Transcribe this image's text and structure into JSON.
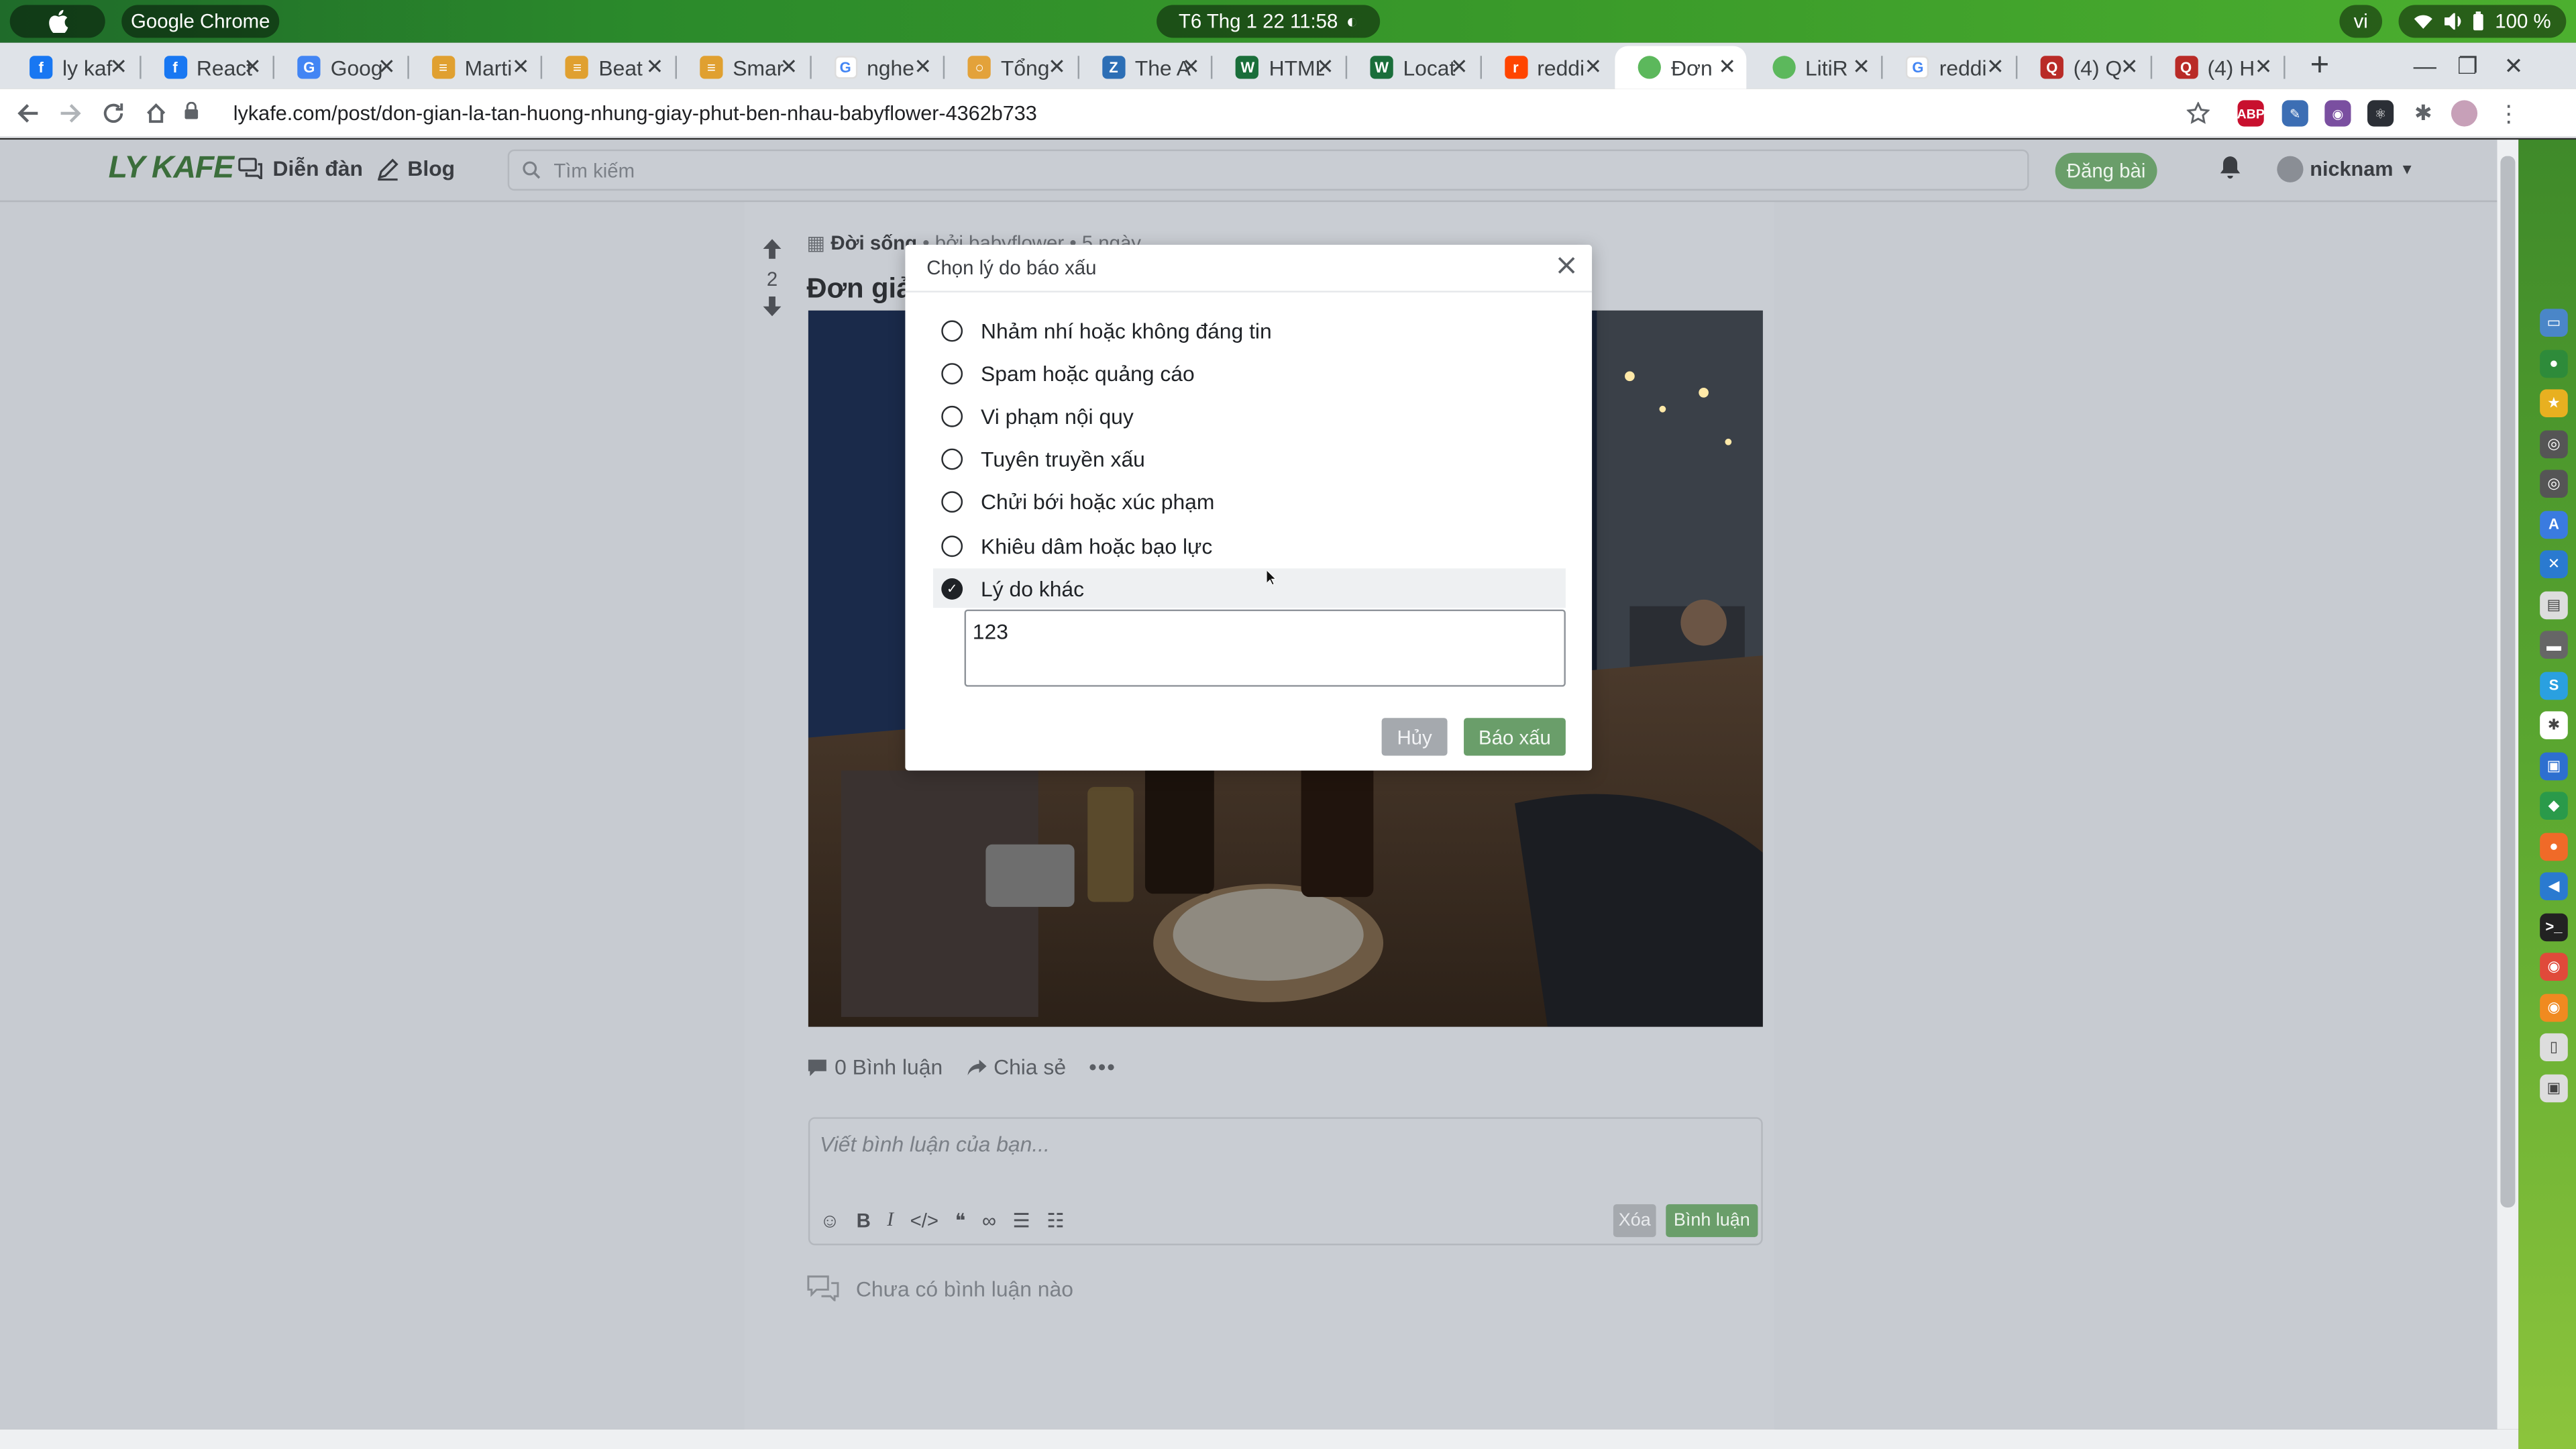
{
  "system_bar": {
    "app_name": "Google Chrome",
    "clock": "T6 Thg 1 22  11:58",
    "input_language": "vi",
    "battery": "100 %"
  },
  "browser": {
    "tabs": [
      {
        "label": "ly kaf",
        "favicon": "facebook-icon",
        "color": "#1877f2",
        "glyph": "f"
      },
      {
        "label": "React",
        "favicon": "facebook-icon",
        "color": "#1877f2",
        "glyph": "f"
      },
      {
        "label": "Goog",
        "favicon": "google-docs-icon",
        "color": "#4285f4",
        "glyph": "G"
      },
      {
        "label": "Marti",
        "favicon": "burger-icon",
        "color": "#e0a030",
        "glyph": "≡"
      },
      {
        "label": "Beat",
        "favicon": "burger-icon",
        "color": "#e0a030",
        "glyph": "≡"
      },
      {
        "label": "Smar",
        "favicon": "burger-icon",
        "color": "#e0a030",
        "glyph": "≡"
      },
      {
        "label": "nghe",
        "favicon": "google-icon",
        "color": "#ffffff",
        "glyph": "G"
      },
      {
        "label": "Tổng",
        "favicon": "circle-icon",
        "color": "#e3a23a",
        "glyph": "○"
      },
      {
        "label": "The A",
        "favicon": "blue-z-icon",
        "color": "#2c6eb5",
        "glyph": "Z"
      },
      {
        "label": "HTML",
        "favicon": "wiki-w-icon",
        "color": "#1a6e3a",
        "glyph": "W"
      },
      {
        "label": "Locat",
        "favicon": "wiki-w-icon",
        "color": "#1a6e3a",
        "glyph": "W"
      },
      {
        "label": "reddi",
        "favicon": "reddit-icon",
        "color": "#ff4500",
        "glyph": "r"
      },
      {
        "label": "Đơn",
        "favicon": "green-dot-icon",
        "color": "#5cb85c",
        "glyph": "",
        "active": true
      },
      {
        "label": "LitiR",
        "favicon": "green-dot-icon",
        "color": "#5cb85c",
        "glyph": ""
      },
      {
        "label": "reddi",
        "favicon": "google-icon",
        "color": "#ffffff",
        "glyph": "G"
      },
      {
        "label": "(4) Q",
        "favicon": "quora-icon",
        "color": "#b92b27",
        "glyph": "Q"
      },
      {
        "label": "(4) H",
        "favicon": "quora-icon",
        "color": "#b92b27",
        "glyph": "Q"
      }
    ],
    "url": "lykafe.com/post/don-gian-la-tan-huong-nhung-giay-phut-ben-nhau-babyflower-4362b733"
  },
  "site": {
    "logo": "LY KAFE",
    "nav": {
      "forum": "Diễn đàn",
      "blog": "Blog"
    },
    "search_placeholder": "Tìm kiếm",
    "post_button": "Đăng bài",
    "username": "nicknam"
  },
  "post": {
    "votes": "2",
    "category": "Đời sống",
    "author_line": "• bởi babyflower • 5 ngày",
    "title_visible": "Đơn giả",
    "comment_count_label": "0 Bình luận",
    "share_label": "Chia sẻ",
    "comment_placeholder": "Viết bình luận của bạn...",
    "clear_button": "Xóa",
    "submit_button": "Bình luận",
    "no_comments": "Chưa có bình luận nào"
  },
  "report_modal": {
    "title": "Chọn lý do báo xấu",
    "options": [
      {
        "label": "Nhảm nhí hoặc không đáng tin",
        "selected": false
      },
      {
        "label": "Spam hoặc quảng cáo",
        "selected": false
      },
      {
        "label": "Vi phạm nội quy",
        "selected": false
      },
      {
        "label": "Tuyên truyền xấu",
        "selected": false
      },
      {
        "label": "Chửi bới hoặc xúc phạm",
        "selected": false
      },
      {
        "label": "Khiêu dâm hoặc bạo lực",
        "selected": false
      },
      {
        "label": "Lý do khác",
        "selected": true
      }
    ],
    "other_reason_value": "123",
    "cancel_button": "Hủy",
    "submit_button": "Báo xấu"
  }
}
